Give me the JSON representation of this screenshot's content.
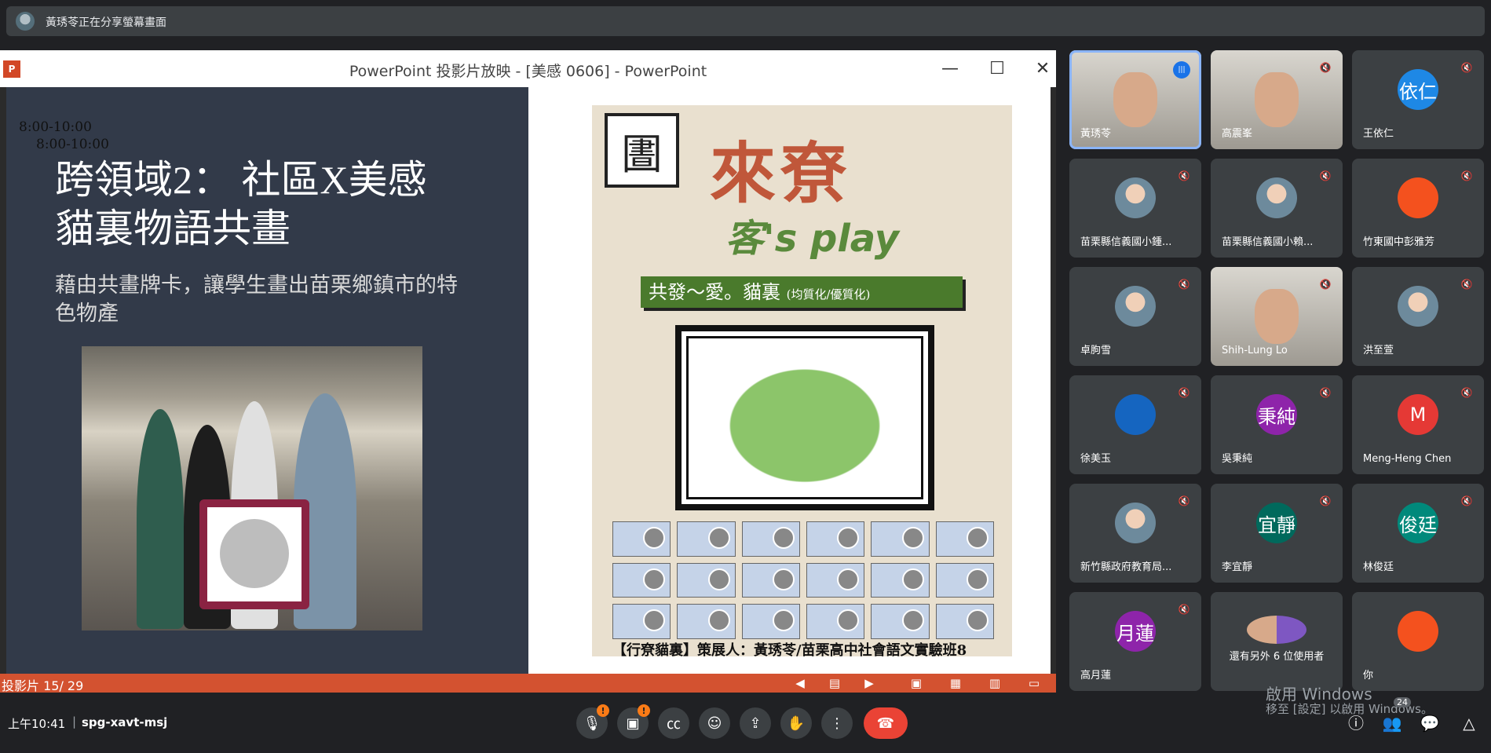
{
  "share_banner": {
    "text": "黃琇苓正在分享螢幕畫面"
  },
  "ppt": {
    "logo": "P",
    "title": "PowerPoint 投影片放映 - [美感 0606] - PowerPoint",
    "minimize": "—",
    "maximize": "☐",
    "close": "✕",
    "slide": {
      "time1": "8:00-10:00",
      "time2": "8:00-10:00",
      "title_line1": "跨領域2： 社區X美感",
      "title_line2": "貓裏物語共畫",
      "body": "藉由共畫牌卡，讓學生畫出苗栗鄉鎮市的特色物產",
      "poster": {
        "logo_char": "圕",
        "main": "來尞",
        "sub": "客's play",
        "banner": "共發～愛。貓裏",
        "banner_small": "(均質化/優質化)",
        "footer": "【行尞貓裏】策展人：黃琇苓/苗栗高中社會語文實驗班8"
      }
    },
    "status": {
      "slide_num": "投影片 15/ 29"
    }
  },
  "participants": [
    {
      "name": "黃琇苓",
      "type": "video",
      "speaking": true
    },
    {
      "name": "高震峯",
      "type": "video",
      "muted": true
    },
    {
      "name": "王依仁",
      "type": "avatar",
      "initial": "依仁",
      "color": "#1e88e5",
      "muted": true
    },
    {
      "name": "苗栗縣信義國小鍾...",
      "type": "photo",
      "muted": true
    },
    {
      "name": "苗栗縣信義國小賴...",
      "type": "photo",
      "muted": true
    },
    {
      "name": "竹東國中彭雅芳",
      "type": "avatar",
      "initial": "",
      "color": "#f4511e",
      "muted": true
    },
    {
      "name": "卓朐雪",
      "type": "photo",
      "muted": true
    },
    {
      "name": "Shih-Lung Lo",
      "type": "video",
      "muted": true
    },
    {
      "name": "洪至萱",
      "type": "photo",
      "muted": true
    },
    {
      "name": "徐美玉",
      "type": "avatar",
      "initial": "",
      "color": "#1565c0",
      "muted": true
    },
    {
      "name": "吳秉純",
      "type": "avatar",
      "initial": "秉純",
      "color": "#8e24aa",
      "muted": true
    },
    {
      "name": "Meng-Heng Chen",
      "type": "avatar",
      "initial": "M",
      "color": "#e53935",
      "muted": true
    },
    {
      "name": "新竹縣政府教育局...",
      "type": "photo",
      "muted": true
    },
    {
      "name": "李宜靜",
      "type": "avatar",
      "initial": "宜靜",
      "color": "#00695c",
      "muted": true
    },
    {
      "name": "林俊廷",
      "type": "avatar",
      "initial": "俊廷",
      "color": "#00897b",
      "muted": true
    },
    {
      "name": "高月蓮",
      "type": "avatar",
      "initial": "月蓮",
      "color": "#8e24aa",
      "muted": true
    },
    {
      "name": "還有另外 6 位使用者",
      "type": "group"
    },
    {
      "name": "你",
      "type": "avatar",
      "initial": "",
      "color": "#f4511e"
    }
  ],
  "watermark": {
    "line1": "啟用 Windows",
    "line2": "移至 [設定] 以啟用 Windows。"
  },
  "bottom": {
    "clock": "上午10:41",
    "separator": "|",
    "meet_code": "spg-xavt-msj",
    "people_count": "24",
    "badge_alert": "!"
  }
}
